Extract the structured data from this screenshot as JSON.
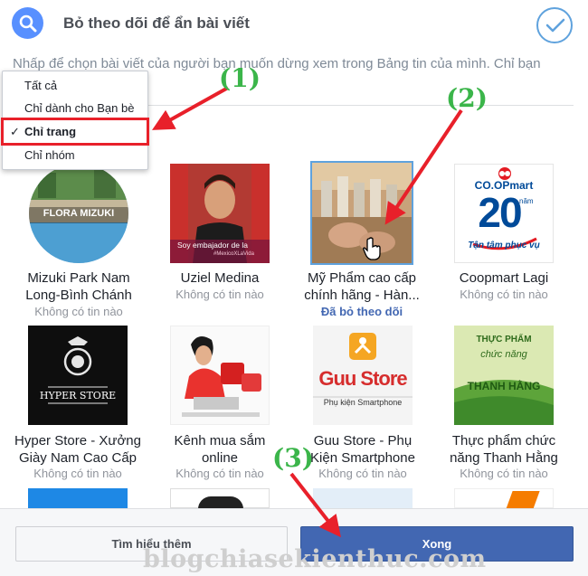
{
  "dialog": {
    "title": "Bỏ theo dõi để ẩn bài viết",
    "description": "Nhấp để chọn bài viết của người bạn muốn dừng xem trong Bảng tin của mình. Chỉ bạn"
  },
  "filter_menu": {
    "items": [
      {
        "label": "Tất cả",
        "selected": false
      },
      {
        "label": "Chỉ dành cho Bạn bè",
        "selected": false
      },
      {
        "label": "Chỉ trang",
        "selected": true
      },
      {
        "label": "Chỉ nhóm",
        "selected": false
      }
    ],
    "check_mark": "✓"
  },
  "pages": [
    {
      "name_line1": "Mizuki Park Nam",
      "name_line2": "Long-Bình Chánh",
      "status": "Không có tin nào",
      "thumb_text": "FLORA MIZUKI"
    },
    {
      "name_line1": "Uziel Medina",
      "name_line2": "",
      "status": "Không có tin nào",
      "thumb_text": "Soy embajador de la",
      "thumb_tag": "#MexicoXLaVida"
    },
    {
      "name_line1": "Mỹ Phẩm cao cấp",
      "name_line2": "chính hãng - Hàn...",
      "status": "Đã bỏ theo dõi"
    },
    {
      "name_line1": "Coopmart Lagi",
      "name_line2": "",
      "status": "Không có tin nào",
      "thumb_brand": "CO.OPmart",
      "thumb_number": "20",
      "thumb_unit": "năm",
      "thumb_slogan": "Tận tâm phục vụ"
    },
    {
      "name_line1": "Hyper Store - Xưởng",
      "name_line2": "Giày Nam Cao Cấp",
      "status": "Không có tin nào",
      "thumb_text": "HYPER STORE"
    },
    {
      "name_line1": "Kênh mua sắm",
      "name_line2": "online",
      "status": "Không có tin nào"
    },
    {
      "name_line1": "Guu Store - Phụ",
      "name_line2": "Kiện Smartphone",
      "status": "Không có tin nào",
      "thumb_brand": "Guu Store",
      "thumb_sub": "Phụ kiện Smartphone"
    },
    {
      "name_line1": "Thực phẩm chức",
      "name_line2": "năng Thanh Hằng",
      "status": "Không có tin nào",
      "thumb_l1": "THỰC PHẨM",
      "thumb_l2": "chức năng",
      "thumb_l3": "THANH HẰNG"
    }
  ],
  "buttons": {
    "learn_more": "Tìm hiểu thêm",
    "done": "Xong"
  },
  "annotations": [
    "(1)",
    "(2)",
    "(3)"
  ],
  "watermark": "blogchiasekienthuc.com",
  "colors": {
    "accent": "#4267b2",
    "annotation": "#3bb54a",
    "arrow": "#e8202a",
    "search_circle": "#5890ff"
  }
}
